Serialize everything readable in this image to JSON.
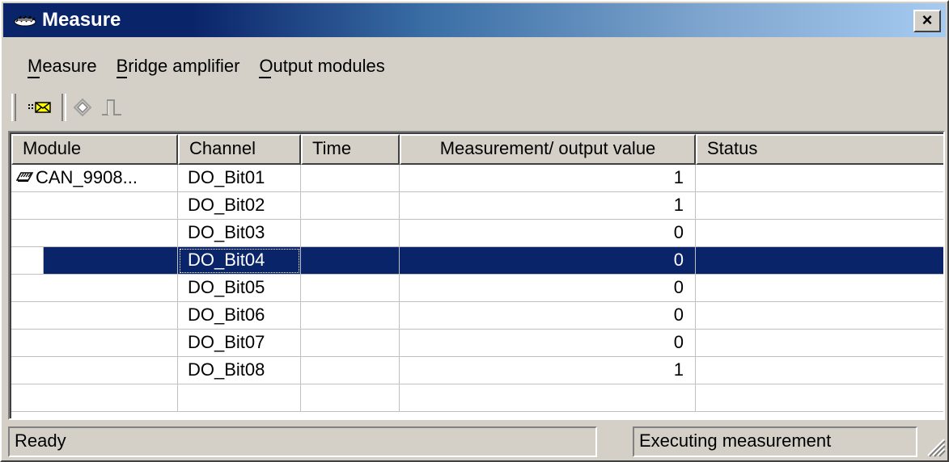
{
  "window": {
    "title": "Measure",
    "close_label": "×",
    "title_gradient": [
      "#0a246a",
      "#a6caf0"
    ]
  },
  "menu": [
    {
      "label": "Measure",
      "mnemonic": "M"
    },
    {
      "label": "Bridge amplifier",
      "mnemonic": "B"
    },
    {
      "label": "Output modules",
      "mnemonic": "O"
    }
  ],
  "toolbar": {
    "buttons": [
      {
        "icon": "messages-icon"
      },
      {
        "icon": "diamond-icon"
      },
      {
        "icon": "pulse-icon"
      }
    ]
  },
  "table": {
    "columns": [
      "Module",
      "Channel",
      "Time",
      "Measurement/ output value",
      "Status"
    ],
    "rows": [
      {
        "module": "CAN_9908...",
        "channel": "DO_Bit01",
        "time": "",
        "value": "1",
        "status": ""
      },
      {
        "module": "",
        "channel": "DO_Bit02",
        "time": "",
        "value": "1",
        "status": ""
      },
      {
        "module": "",
        "channel": "DO_Bit03",
        "time": "",
        "value": "0",
        "status": ""
      },
      {
        "module": "",
        "channel": "DO_Bit04",
        "time": "",
        "value": "0",
        "status": "",
        "selected": true
      },
      {
        "module": "",
        "channel": "DO_Bit05",
        "time": "",
        "value": "0",
        "status": ""
      },
      {
        "module": "",
        "channel": "DO_Bit06",
        "time": "",
        "value": "0",
        "status": ""
      },
      {
        "module": "",
        "channel": "DO_Bit07",
        "time": "",
        "value": "0",
        "status": ""
      },
      {
        "module": "",
        "channel": "DO_Bit08",
        "time": "",
        "value": "1",
        "status": ""
      },
      {
        "module": "",
        "channel": "",
        "time": "",
        "value": "",
        "status": ""
      }
    ],
    "selection_color": "#0a246a"
  },
  "statusbar": {
    "left": "Ready",
    "right": "Executing measurement"
  }
}
